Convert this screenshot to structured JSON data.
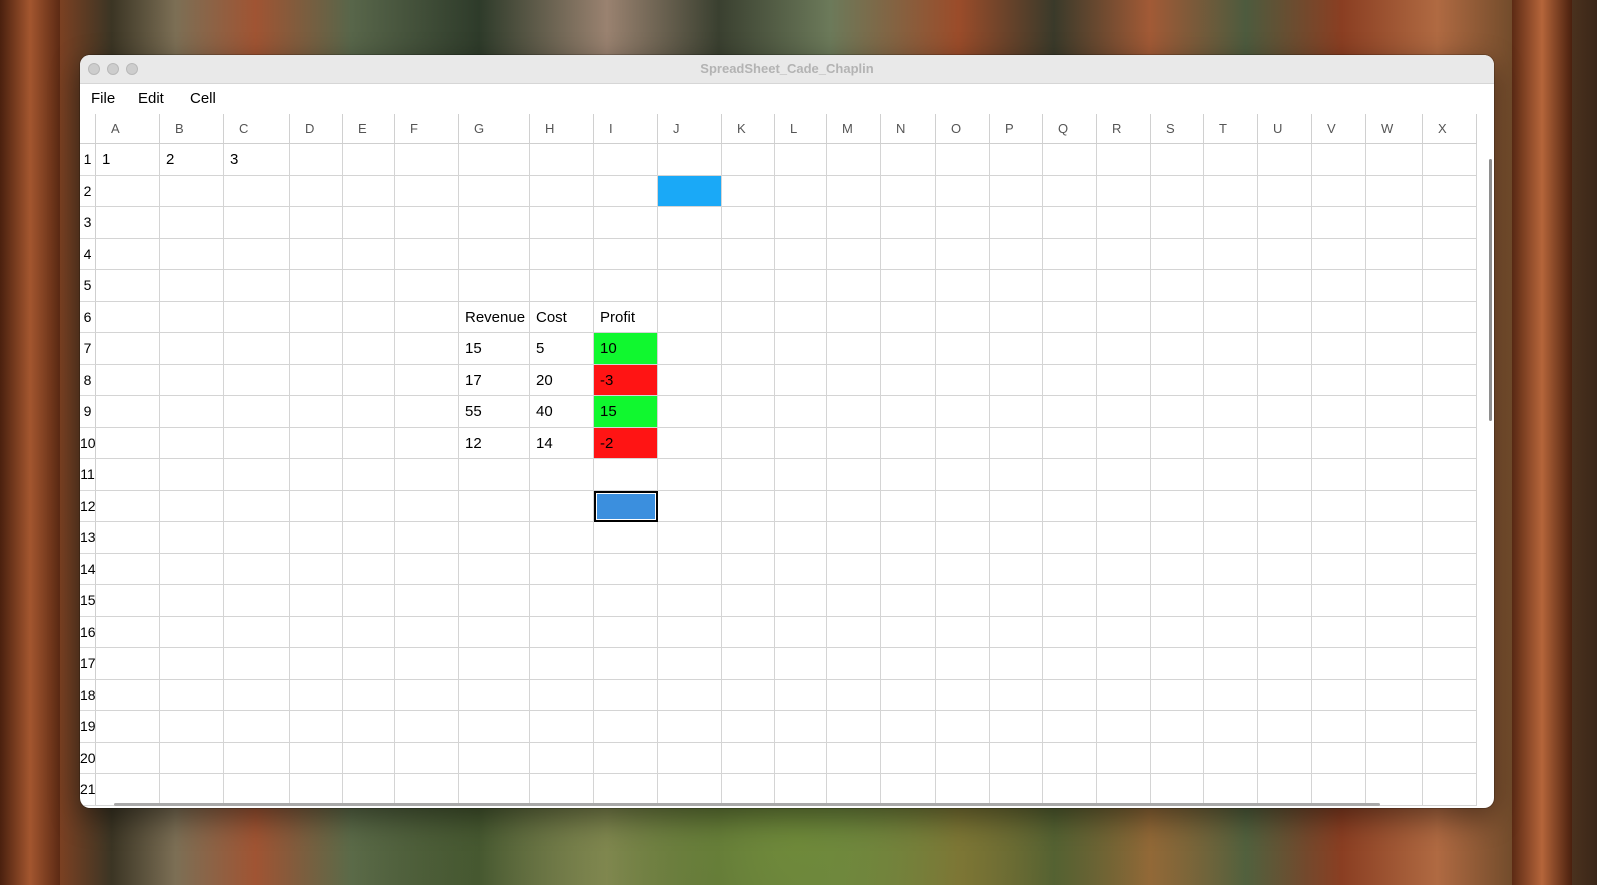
{
  "window": {
    "title": "SpreadSheet_Cade_Chaplin"
  },
  "menu": {
    "items": [
      {
        "label": "File"
      },
      {
        "label": "Edit"
      },
      {
        "label": "Cell"
      }
    ]
  },
  "sheet": {
    "columns": [
      "A",
      "B",
      "C",
      "D",
      "E",
      "F",
      "G",
      "H",
      "I",
      "J",
      "K",
      "L",
      "M",
      "N",
      "O",
      "P",
      "Q",
      "R",
      "S",
      "T",
      "U",
      "V",
      "W",
      "X"
    ],
    "rows": [
      "1",
      "2",
      "3",
      "4",
      "5",
      "6",
      "7",
      "8",
      "9",
      "10",
      "11",
      "12",
      "13",
      "14",
      "15",
      "16",
      "17",
      "18",
      "19",
      "20",
      "21"
    ],
    "cells": [
      {
        "ref": "A1",
        "value": "1"
      },
      {
        "ref": "B1",
        "value": "2"
      },
      {
        "ref": "C1",
        "value": "3"
      },
      {
        "ref": "J2",
        "value": "",
        "fill": "#1aa9f7"
      },
      {
        "ref": "G6",
        "value": "Revenue"
      },
      {
        "ref": "H6",
        "value": "Cost"
      },
      {
        "ref": "I6",
        "value": "Profit"
      },
      {
        "ref": "G7",
        "value": "15"
      },
      {
        "ref": "H7",
        "value": "5"
      },
      {
        "ref": "I7",
        "value": "10",
        "fill": "#10f82f"
      },
      {
        "ref": "G8",
        "value": "17"
      },
      {
        "ref": "H8",
        "value": "20"
      },
      {
        "ref": "I8",
        "value": "-3",
        "fill": "#ff1414"
      },
      {
        "ref": "G9",
        "value": "55"
      },
      {
        "ref": "H9",
        "value": "40"
      },
      {
        "ref": "I9",
        "value": "15",
        "fill": "#10f82f"
      },
      {
        "ref": "G10",
        "value": "12"
      },
      {
        "ref": "H10",
        "value": "14"
      },
      {
        "ref": "I10",
        "value": "-2",
        "fill": "#ff1414"
      }
    ],
    "selected_cell": {
      "ref": "I12",
      "fill": "#3b8fde"
    }
  }
}
